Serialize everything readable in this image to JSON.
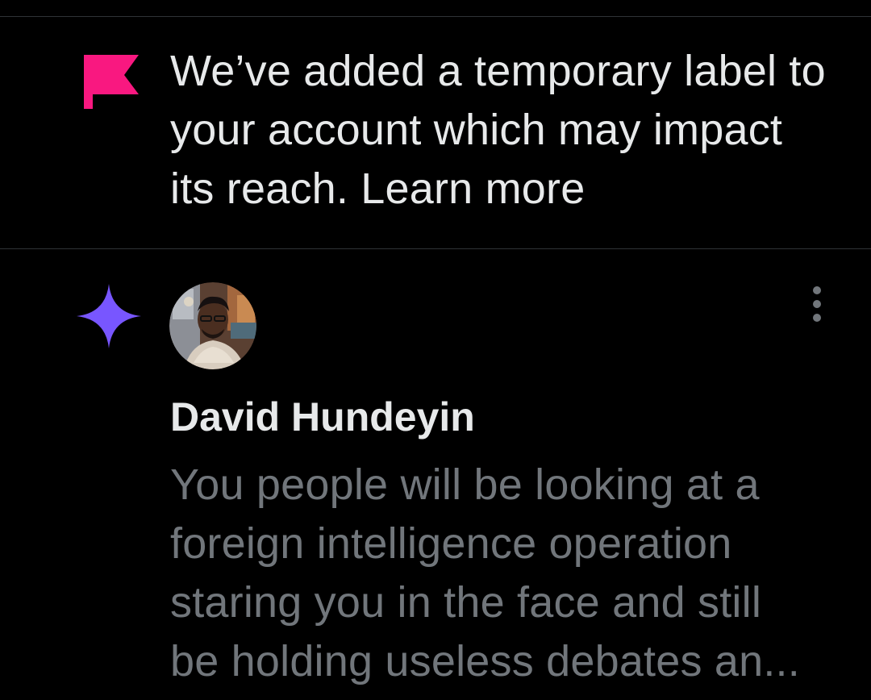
{
  "colors": {
    "background": "#000000",
    "divider": "#2f3336",
    "primary_text": "#e7e9ea",
    "secondary_text": "#71767b",
    "flag": "#f91880",
    "sparkle": "#7856ff"
  },
  "notice": {
    "icon": "flag-icon",
    "text": "We’ve added a temporary label to your account which may impact its reach.",
    "link_label": "Learn more"
  },
  "post": {
    "badge_icon": "sparkle-icon",
    "more_icon": "more-vertical-icon",
    "author_name": "David Hundeyin",
    "text_lines": [
      "You people will be looking at a",
      "foreign intelligence operation",
      "staring you in the face and still",
      "be holding useless debates an..."
    ]
  }
}
